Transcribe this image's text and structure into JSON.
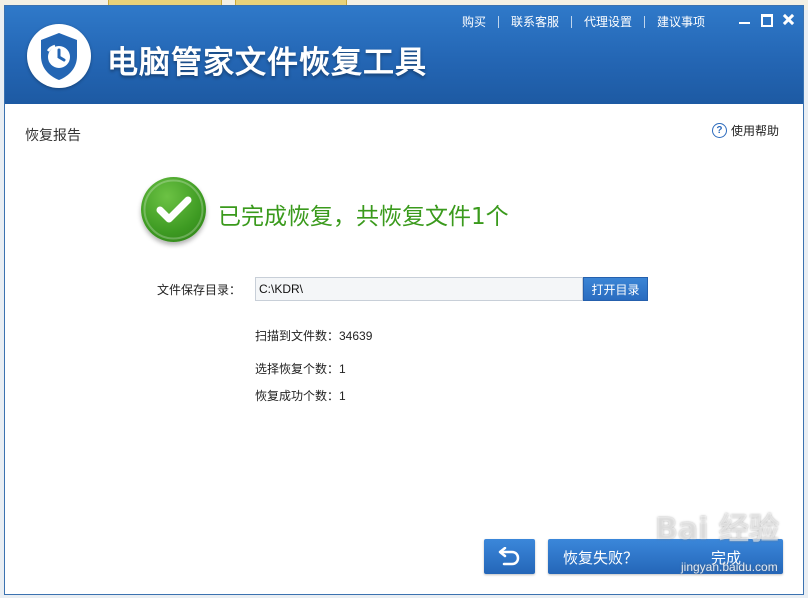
{
  "window": {
    "title": "电脑管家文件恢复工具",
    "menu": [
      "购买",
      "联系客服",
      "代理设置",
      "建议事项"
    ]
  },
  "report": {
    "section_title": "恢复报告",
    "help_label": "使用帮助",
    "success_message": "已完成恢复，共恢复文件1个"
  },
  "save_dir": {
    "label": "文件保存目录：",
    "value": "C:\\KDR\\",
    "open_button": "打开目录"
  },
  "stats": {
    "scanned": "扫描到文件数：34639",
    "selected": "选择恢复个数：1",
    "succeeded": "恢复成功个数：1"
  },
  "buttons": {
    "failed": "恢复失败？",
    "finish": "完成"
  },
  "watermark": {
    "brand": "Bai 经验",
    "url": "jingyan.baidu.com"
  },
  "colors": {
    "title_bar": "#2466b4",
    "success_green": "#3a9a1c",
    "button_blue": "#2a6cc0"
  },
  "icons": {
    "logo": "shield-clock-icon",
    "success": "checkmark-icon",
    "help": "question-circle-icon",
    "back": "undo-arrow-icon"
  }
}
